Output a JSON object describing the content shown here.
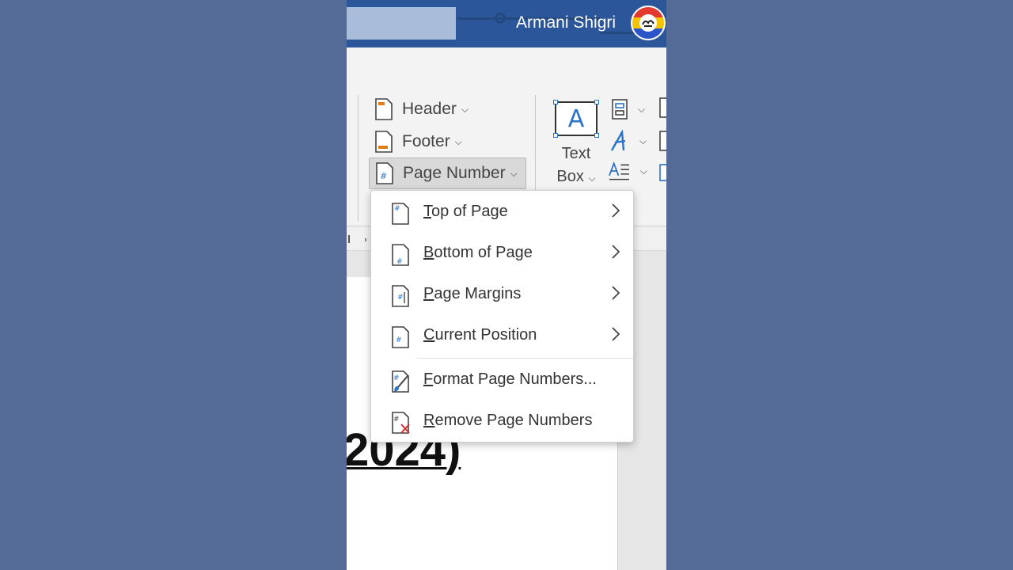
{
  "colors": {
    "page_background": "#546b97",
    "title_bar": "#2b579a",
    "accent": "#2a72c8"
  },
  "titlebar": {
    "user_name": "Armani Shigri"
  },
  "ribbon": {
    "header_label": "Header",
    "footer_label": "Footer",
    "page_number_label": "Page Number",
    "textbox_icon_letter": "A",
    "textbox_line1": "Text",
    "textbox_line2": "Box",
    "group_label_fragment": "t"
  },
  "document": {
    "heading_fragment": "2024)"
  },
  "menu": {
    "items": [
      {
        "accel": "T",
        "rest": "op of Page",
        "has_submenu": true,
        "icon": "page-number-top-icon"
      },
      {
        "accel": "B",
        "rest": "ottom of Page",
        "has_submenu": true,
        "icon": "page-number-bottom-icon"
      },
      {
        "accel": "P",
        "rest": "age Margins",
        "has_submenu": true,
        "icon": "page-number-margin-icon"
      },
      {
        "accel": "C",
        "rest": "urrent Position",
        "has_submenu": true,
        "icon": "page-number-current-icon"
      },
      {
        "accel": "F",
        "rest": "ormat Page Numbers...",
        "has_submenu": false,
        "icon": "format-page-numbers-icon"
      },
      {
        "accel": "R",
        "rest": "emove Page Numbers",
        "has_submenu": false,
        "icon": "remove-page-numbers-icon"
      }
    ]
  }
}
